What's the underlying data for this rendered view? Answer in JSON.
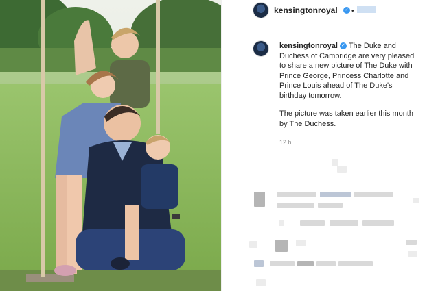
{
  "post": {
    "username": "kensingtonroyal",
    "verified_icon": "verified-badge-icon",
    "caption_p1": "The Duke and Duchess of Cambridge are very pleased to share a new picture of The Duke with Prince George, Princess Charlotte and Prince Louis ahead of The Duke's birthday tomorrow.",
    "caption_p2": "The picture was taken earlier this month by The Duchess.",
    "timestamp": "12 h"
  },
  "header": {
    "username": "kensingtonroyal",
    "separator": "•"
  },
  "colors": {
    "verified": "#3897f0",
    "text": "#262626",
    "muted": "#8e8e8e"
  }
}
